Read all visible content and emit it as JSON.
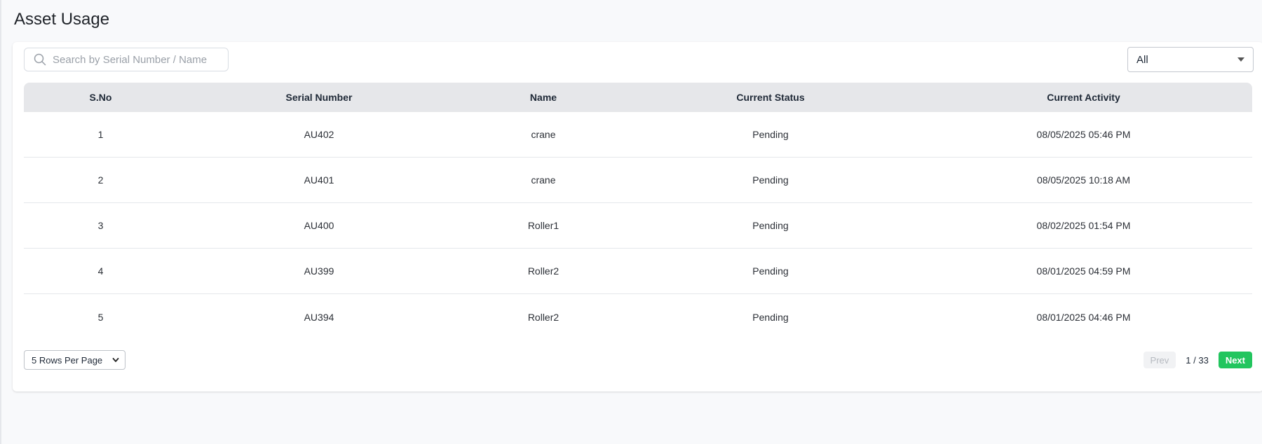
{
  "page": {
    "title": "Asset Usage"
  },
  "filters": {
    "search_placeholder": "Search by Serial Number / Name",
    "search_value": "",
    "status_selected": "All"
  },
  "table": {
    "headers": [
      "S.No",
      "Serial Number",
      "Name",
      "Current Status",
      "Current Activity"
    ],
    "rows": [
      [
        "1",
        "AU402",
        "crane",
        "Pending",
        "08/05/2025 05:46 PM"
      ],
      [
        "2",
        "AU401",
        "crane",
        "Pending",
        "08/05/2025 10:18 AM"
      ],
      [
        "3",
        "AU400",
        "Roller1",
        "Pending",
        "08/02/2025 01:54 PM"
      ],
      [
        "4",
        "AU399",
        "Roller2",
        "Pending",
        "08/01/2025 04:59 PM"
      ],
      [
        "5",
        "AU394",
        "Roller2",
        "Pending",
        "08/01/2025 04:46 PM"
      ]
    ]
  },
  "pagination": {
    "rows_per_page_label": "5 Rows Per Page",
    "prev_label": "Prev",
    "next_label": "Next",
    "page_info": "1 / 33"
  },
  "colors": {
    "accent": "#22c55e",
    "header_bg": "#e6e7ea"
  },
  "icons": {
    "search": "search-icon",
    "select_caret": "caret-down-icon",
    "rows_chevron": "chevron-down-icon"
  }
}
